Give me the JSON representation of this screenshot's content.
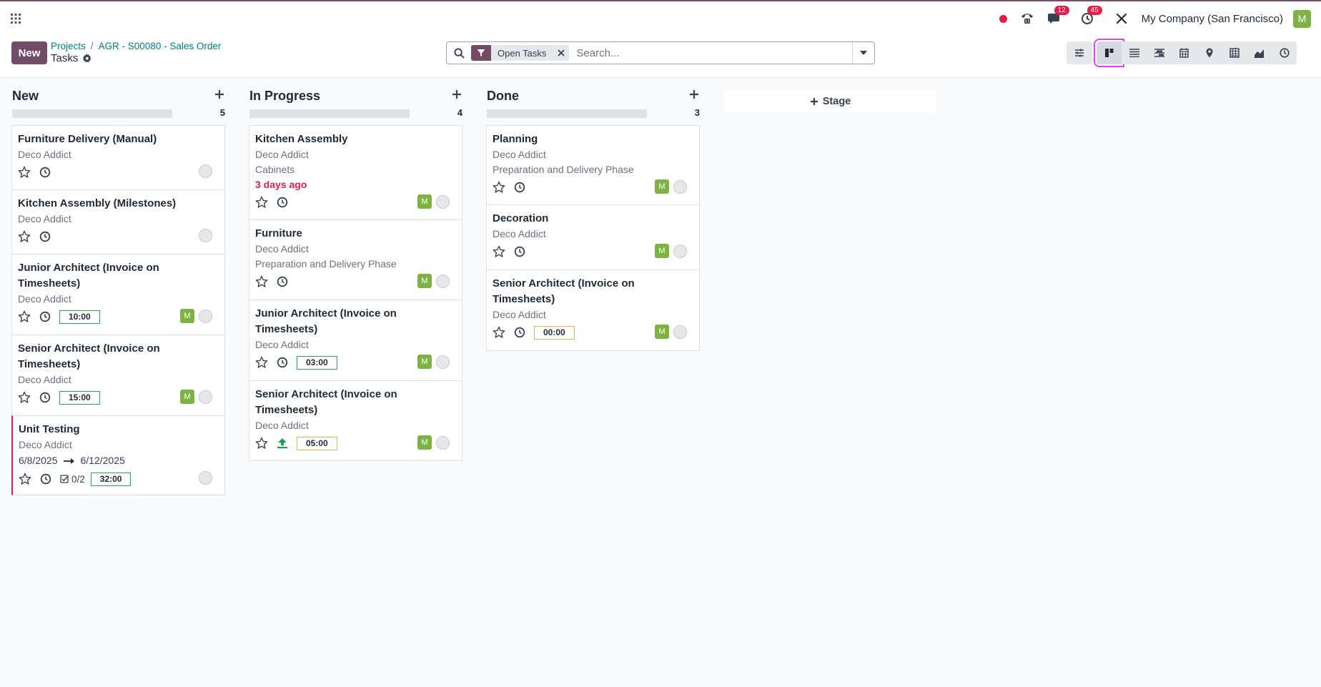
{
  "topbar": {
    "notifications": {
      "messages_badge": "12",
      "activities_badge": "45"
    },
    "company": "My Company (San Francisco)",
    "user_initial": "M"
  },
  "controls": {
    "new_label": "New",
    "breadcrumb": {
      "projects": "Projects",
      "sales_order": "AGR - S00080 - Sales Order"
    },
    "title": "Tasks",
    "search": {
      "facet": "Open Tasks",
      "placeholder": "Search..."
    }
  },
  "columns": [
    {
      "title": "New",
      "count": "5",
      "cards": [
        {
          "name": "Furniture Delivery (Manual)",
          "partner": "Deco Addict"
        },
        {
          "name": "Kitchen Assembly (Milestones)",
          "partner": "Deco Addict"
        },
        {
          "name": "Junior Architect (Invoice on Timesheets)",
          "partner": "Deco Addict",
          "hours": "10:00",
          "avatar": "M"
        },
        {
          "name": "Senior Architect (Invoice on Timesheets)",
          "partner": "Deco Addict",
          "hours": "15:00",
          "avatar": "M"
        },
        {
          "name": "Unit Testing",
          "partner": "Deco Addict",
          "date_start": "6/8/2025",
          "date_end": "6/12/2025",
          "checklist": "0/2",
          "hours": "32:00"
        }
      ]
    },
    {
      "title": "In Progress",
      "count": "4",
      "cards": [
        {
          "name": "Kitchen Assembly",
          "partner": "Deco Addict",
          "tag": "Cabinets",
          "deadline": "3 days ago",
          "avatar": "M"
        },
        {
          "name": "Furniture",
          "partner": "Deco Addict",
          "milestone": "Preparation and Delivery Phase",
          "avatar": "M"
        },
        {
          "name": "Junior Architect (Invoice on Timesheets)",
          "partner": "Deco Addict",
          "hours": "03:00",
          "avatar": "M"
        },
        {
          "name": "Senior Architect (Invoice on Timesheets)",
          "partner": "Deco Addict",
          "hours": "05:00",
          "avatar": "M"
        }
      ]
    },
    {
      "title": "Done",
      "count": "3",
      "cards": [
        {
          "name": "Planning",
          "partner": "Deco Addict",
          "milestone": "Preparation and Delivery Phase",
          "avatar": "M"
        },
        {
          "name": "Decoration",
          "partner": "Deco Addict",
          "avatar": "M"
        },
        {
          "name": "Senior Architect (Invoice on Timesheets)",
          "partner": "Deco Addict",
          "hours": "00:00",
          "avatar": "M"
        }
      ]
    }
  ],
  "add_stage_label": "Stage",
  "colors": {
    "brand": "#714b67",
    "link": "#017e84",
    "danger": "#e11d48",
    "avatar": "#7cb342",
    "hours_ok": "#28a745",
    "hours_warn": "#f0ad4e"
  },
  "icons": {
    "topbar": [
      "apps-grid-icon",
      "record-dot-icon",
      "phone-icon",
      "chat-icon",
      "activity-clock-icon",
      "debug-tools-icon"
    ],
    "views": [
      "kanban-icon",
      "list-icon",
      "gantt-icon",
      "calendar-icon",
      "map-icon",
      "pivot-icon",
      "graph-icon",
      "activity-icon"
    ]
  }
}
